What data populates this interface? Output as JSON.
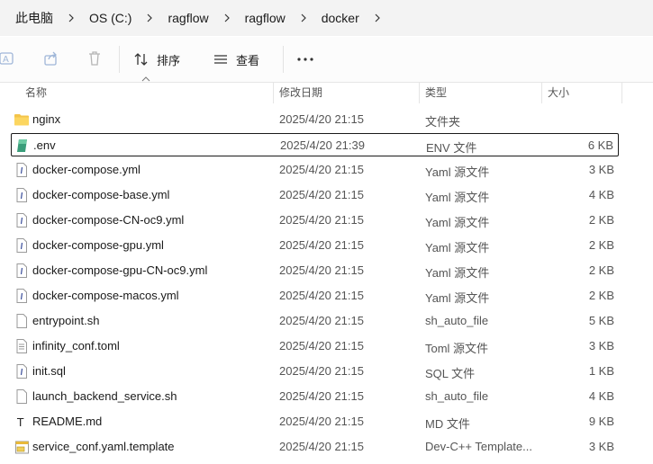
{
  "breadcrumb": [
    "此电脑",
    "OS (C:)",
    "ragflow",
    "ragflow",
    "docker"
  ],
  "toolbar": {
    "sort_label": "排序",
    "view_label": "查看",
    "more_label": "···"
  },
  "columns": {
    "name": "名称",
    "modified": "修改日期",
    "type": "类型",
    "size": "大小"
  },
  "files": [
    {
      "name": "nginx",
      "modified": "2025/4/20 21:15",
      "type": "文件夹",
      "size": "",
      "icon": "folder-icon"
    },
    {
      "name": ".env",
      "modified": "2025/4/20 21:39",
      "type": "ENV 文件",
      "size": "6 KB",
      "icon": "env-file-icon",
      "focused": true
    },
    {
      "name": "docker-compose.yml",
      "modified": "2025/4/20 21:15",
      "type": "Yaml 源文件",
      "size": "3 KB",
      "icon": "yaml-file-icon"
    },
    {
      "name": "docker-compose-base.yml",
      "modified": "2025/4/20 21:15",
      "type": "Yaml 源文件",
      "size": "4 KB",
      "icon": "yaml-file-icon"
    },
    {
      "name": "docker-compose-CN-oc9.yml",
      "modified": "2025/4/20 21:15",
      "type": "Yaml 源文件",
      "size": "2 KB",
      "icon": "yaml-file-icon"
    },
    {
      "name": "docker-compose-gpu.yml",
      "modified": "2025/4/20 21:15",
      "type": "Yaml 源文件",
      "size": "2 KB",
      "icon": "yaml-file-icon"
    },
    {
      "name": "docker-compose-gpu-CN-oc9.yml",
      "modified": "2025/4/20 21:15",
      "type": "Yaml 源文件",
      "size": "2 KB",
      "icon": "yaml-file-icon"
    },
    {
      "name": "docker-compose-macos.yml",
      "modified": "2025/4/20 21:15",
      "type": "Yaml 源文件",
      "size": "2 KB",
      "icon": "yaml-file-icon"
    },
    {
      "name": "entrypoint.sh",
      "modified": "2025/4/20 21:15",
      "type": "sh_auto_file",
      "size": "5 KB",
      "icon": "generic-file-icon"
    },
    {
      "name": "infinity_conf.toml",
      "modified": "2025/4/20 21:15",
      "type": "Toml 源文件",
      "size": "3 KB",
      "icon": "text-file-icon"
    },
    {
      "name": "init.sql",
      "modified": "2025/4/20 21:15",
      "type": "SQL 文件",
      "size": "1 KB",
      "icon": "yaml-file-icon"
    },
    {
      "name": "launch_backend_service.sh",
      "modified": "2025/4/20 21:15",
      "type": "sh_auto_file",
      "size": "4 KB",
      "icon": "generic-file-icon"
    },
    {
      "name": "README.md",
      "modified": "2025/4/20 21:15",
      "type": "MD 文件",
      "size": "9 KB",
      "icon": "markdown-file-icon"
    },
    {
      "name": "service_conf.yaml.template",
      "modified": "2025/4/20 21:15",
      "type": "Dev-C++ Template...",
      "size": "3 KB",
      "icon": "template-file-icon"
    }
  ]
}
